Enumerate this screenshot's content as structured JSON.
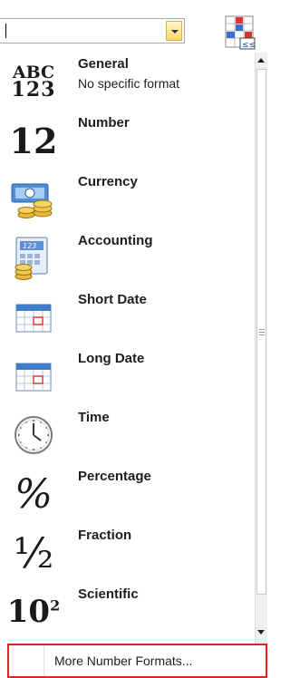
{
  "combo": {
    "value": ""
  },
  "items": [
    {
      "name": "General",
      "description": "No specific format",
      "icon": "abc-123-icon",
      "icon_text_top": "ABC",
      "icon_text_bottom": "123"
    },
    {
      "name": "Number",
      "icon": "number-12-icon",
      "icon_text": "12"
    },
    {
      "name": "Currency",
      "icon": "currency-bills-coins-icon"
    },
    {
      "name": "Accounting",
      "icon": "accounting-calculator-coins-icon",
      "icon_text": "123"
    },
    {
      "name": "Short Date",
      "icon": "calendar-icon"
    },
    {
      "name": "Long Date",
      "icon": "calendar-icon"
    },
    {
      "name": "Time",
      "icon": "clock-icon"
    },
    {
      "name": "Percentage",
      "icon": "percent-icon",
      "icon_text": "%"
    },
    {
      "name": "Fraction",
      "icon": "fraction-icon",
      "icon_text": "½"
    },
    {
      "name": "Scientific",
      "icon": "exponent-icon",
      "icon_text": "10",
      "icon_sup": "2"
    }
  ],
  "footer": {
    "more_label": "More Number Formats..."
  },
  "colors": {
    "highlight_border": "#e02424",
    "accent_gold": "#d9a11f",
    "accent_blue": "#3a77c4"
  }
}
